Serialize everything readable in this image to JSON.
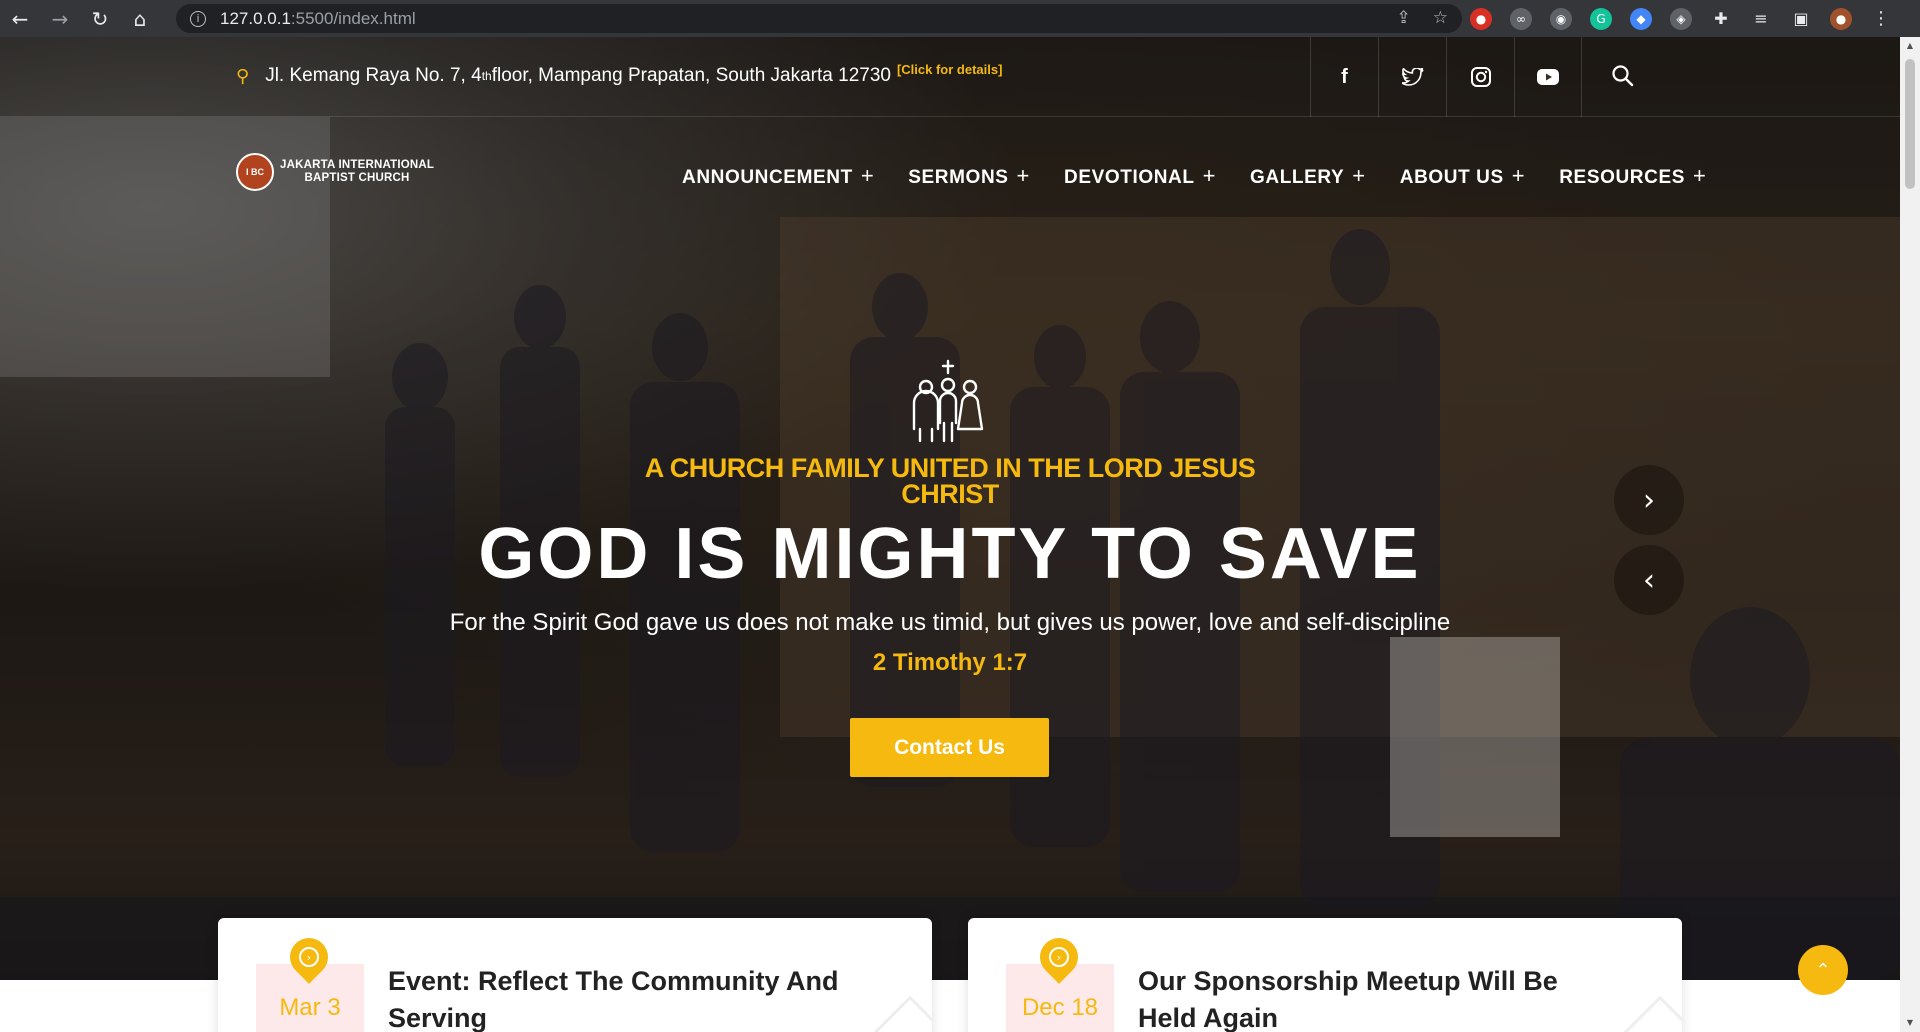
{
  "browser": {
    "url_host": "127.0.0.1",
    "url_path": ":5500/index.html"
  },
  "topbar": {
    "address_main": "Jl. Kemang Raya No. 7, 4",
    "address_sup": "th",
    "address_rest": " floor, Mampang Prapatan, South Jakarta 12730",
    "details_link": "[Click for details]"
  },
  "logo": {
    "seal_text": "I BC",
    "name_line1": "JAKARTA INTERNATIONAL",
    "name_line2": "BAPTIST CHURCH"
  },
  "nav": {
    "items": [
      {
        "label": "ANNOUNCEMENT"
      },
      {
        "label": "SERMONS"
      },
      {
        "label": "DEVOTIONAL"
      },
      {
        "label": "GALLERY"
      },
      {
        "label": "ABOUT US"
      },
      {
        "label": "RESOURCES"
      }
    ]
  },
  "hero": {
    "tagline": "A CHURCH FAMILY UNITED IN THE LORD JESUS CHRIST",
    "headline": "GOD IS MIGHTY TO SAVE",
    "verse": "For the Spirit God gave us does not make us timid, but gives us power, love and self-discipline",
    "reference": "2 Timothy 1:7",
    "cta_label": "Contact Us"
  },
  "cards": [
    {
      "date": "Mar 3",
      "title": "Event: Reflect The Community And Serving"
    },
    {
      "date": "Dec 18",
      "title": "Our Sponsorship Meetup Will Be Held Again"
    }
  ],
  "colors": {
    "accent": "#f5b90f",
    "chrome": "#35363a",
    "date_bg": "#fde9ea"
  },
  "icons": {
    "social": [
      "facebook-icon",
      "twitter-icon",
      "instagram-icon",
      "youtube-icon"
    ]
  }
}
